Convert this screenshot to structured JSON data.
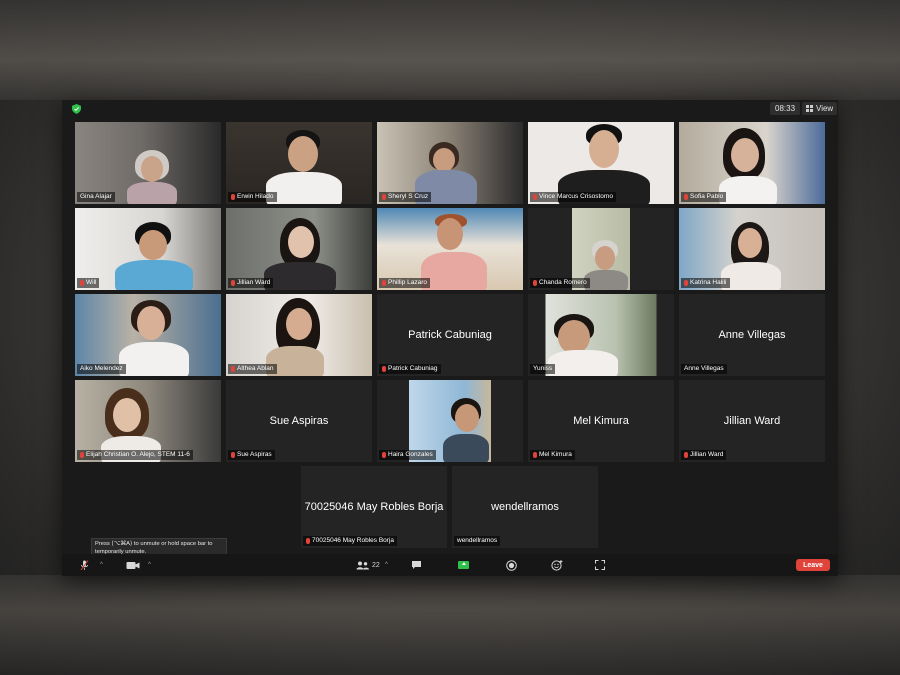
{
  "meeting": {
    "time": "08:33",
    "view_label": "View"
  },
  "participants": [
    {
      "name": "Gina Alajar",
      "video": true,
      "muted": false,
      "active_speaker": true
    },
    {
      "name": "Erwin Hilado",
      "video": true,
      "muted": true
    },
    {
      "name": "Sheryl S Cruz",
      "video": true,
      "muted": true
    },
    {
      "name": "Vince Marcus Crisostomo",
      "video": true,
      "muted": true
    },
    {
      "name": "Sofia Pablo",
      "video": true,
      "muted": true
    },
    {
      "name": "Will",
      "video": true,
      "muted": true
    },
    {
      "name": "Jillian Ward",
      "video": true,
      "muted": true
    },
    {
      "name": "Phillip Lazaro",
      "video": true,
      "muted": true
    },
    {
      "name": "Chanda Romero",
      "video": true,
      "muted": true
    },
    {
      "name": "Katrina Halili",
      "video": true,
      "muted": true
    },
    {
      "name": "Aiko Melendez",
      "video": true,
      "muted": false
    },
    {
      "name": "Althea Ablan",
      "video": true,
      "muted": true
    },
    {
      "name": "Patrick Cabuniag",
      "video": false,
      "muted": true
    },
    {
      "name": "Yuniss",
      "video": true,
      "muted": false
    },
    {
      "name": "Anne Villegas",
      "video": false,
      "muted": false
    },
    {
      "name": "Elijah Christian O. Alejo, STEM 11-6",
      "video": true,
      "muted": true
    },
    {
      "name": "Sue Aspiras",
      "video": false,
      "muted": true
    },
    {
      "name": "Haira Gonzales",
      "video": true,
      "muted": true
    },
    {
      "name": "Mel Kimura",
      "video": false,
      "muted": true
    },
    {
      "name": "Jillian Ward",
      "video": false,
      "muted": true
    },
    {
      "name": "70025046 May Robles Borja",
      "video": false,
      "muted": true
    },
    {
      "name": "wendellramos",
      "video": false,
      "muted": false
    }
  ],
  "toolbar": {
    "tooltip": "Press ⟨⌥⌘A⟩ to unmute or hold space bar to temporarily unmute.",
    "participants_count": "22",
    "leave_label": "Leave"
  },
  "colors": {
    "active_speaker": "#a6d83a",
    "leave": "#e0433a",
    "share": "#2fbf4a"
  }
}
